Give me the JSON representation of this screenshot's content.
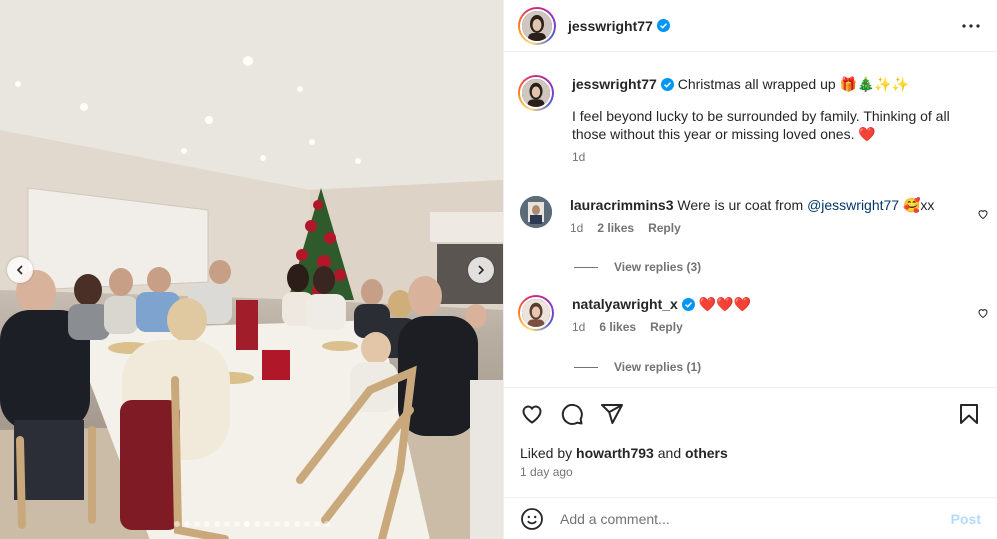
{
  "post": {
    "username": "jesswright77",
    "more_icon": "more-horizontal-icon"
  },
  "caption": {
    "username": "jesswright77",
    "title": "Christmas all wrapped up 🎁🎄✨✨",
    "text": "I feel beyond lucky to be surrounded by family. Thinking of all those without this year or missing loved ones. ❤️",
    "age": "1d"
  },
  "comments": [
    {
      "username": "lauracrimmins3",
      "text_before": "Were is ur coat from ",
      "mention": "@jesswright77",
      "text_after": " 🥰xx",
      "age": "1d",
      "likes": "2 likes",
      "reply": "Reply",
      "view_replies": "View replies (3)"
    },
    {
      "username": "natalyawright_x",
      "text": "❤️❤️❤️",
      "age": "1d",
      "likes": "6 likes",
      "reply": "Reply",
      "view_replies": "View replies (1)"
    }
  ],
  "footer": {
    "liked_prefix": "Liked by ",
    "liked_user": "howarth793",
    "liked_mid": " and ",
    "liked_others": "others",
    "time_ago": "1 day ago"
  },
  "add_comment": {
    "placeholder": "Add a comment...",
    "post_label": "Post"
  },
  "carousel": {
    "dot_count": 16,
    "active_index": 7
  },
  "colors": {
    "verified": "#0095f6",
    "heart": "#ed4956",
    "link": "#00376b",
    "post_disabled": "#b3dbff"
  }
}
